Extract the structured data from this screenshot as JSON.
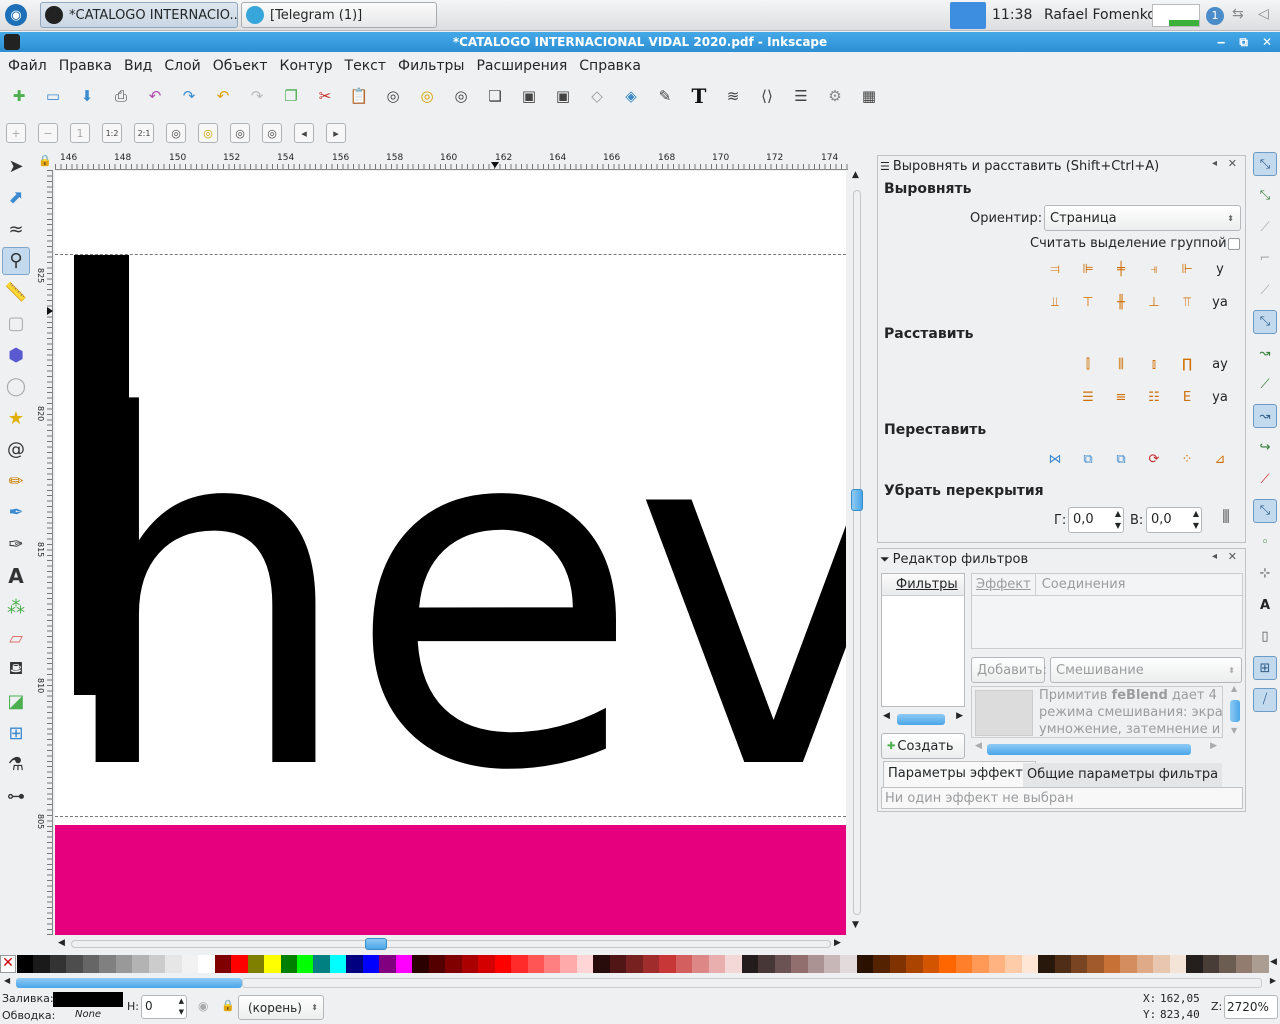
{
  "taskbar": {
    "tasks": [
      {
        "label": "*CATALOGO INTERNACIO..."
      },
      {
        "label": "[Telegram (1)]"
      }
    ],
    "clock": "11:38",
    "user": "Rafael Fomenko",
    "badge": "1"
  },
  "window": {
    "title": "*CATALOGO INTERNACIONAL VIDAL 2020.pdf - Inkscape",
    "controls": [
      "‒",
      "⧉",
      "✕"
    ]
  },
  "menu": [
    "Файл",
    "Правка",
    "Вид",
    "Слой",
    "Объект",
    "Контур",
    "Текст",
    "Фильтры",
    "Расширения",
    "Справка"
  ],
  "toolbar_icons": [
    "new-icon",
    "open-icon",
    "save-icon",
    "print-icon",
    "import-icon",
    "export-icon",
    "undo-icon",
    "redo-icon",
    "copy-icon",
    "cut-icon",
    "paste-icon",
    "zoom-selection-icon",
    "zoom-drawing-icon",
    "zoom-page-icon",
    "duplicate-icon",
    "clone-icon",
    "unlink-clone-icon",
    "group-icon",
    "ungroup-icon",
    "fill-stroke-icon",
    "text-font-icon",
    "layers-icon",
    "xml-editor-icon",
    "align-icon",
    "preferences-icon",
    "document-properties-icon"
  ],
  "zoom_toolbar": {
    "labels": [
      "+",
      "−",
      "1",
      "1:2",
      "2:1"
    ]
  },
  "ruler": {
    "ticks": [
      "146",
      "148",
      "150",
      "152",
      "154",
      "156",
      "158",
      "160",
      "162",
      "164",
      "166",
      "168",
      "170",
      "172",
      "174"
    ],
    "vticks": [
      "825",
      "820",
      "815",
      "810",
      "805"
    ]
  },
  "canvas": {
    "text": "hev",
    "page_color": "#ffffff",
    "band_color": "#e6007e"
  },
  "align_panel": {
    "title": "Выровнять и расставить (Shift+Ctrl+A)",
    "align_heading": "Выровнять",
    "relative_label": "Ориентир:",
    "relative_value": "Страница",
    "group_label": "Считать выделение группой:",
    "distribute_heading": "Расставить",
    "rearrange_heading": "Переставить",
    "overlap_heading": "Убрать перекрытия",
    "h_label": "Г:",
    "h_value": "0,0",
    "v_label": "В:",
    "v_value": "0,0"
  },
  "filter_panel": {
    "title": "Редактор фильтров",
    "col_filters": "Фильтры",
    "col_effect": "Эффект",
    "col_connections": "Соединения",
    "add_label": "Добавить:",
    "add_value": "Смешивание",
    "desc_prefix": "Примитив ",
    "desc_bold": "feBlend",
    "desc_line1": " дает 4",
    "desc_line2": "режима смешивания: экран,",
    "desc_line3": "умножение, затемнение и",
    "create_label": "Создать",
    "tab_effect": "Параметры эффекта",
    "tab_general": "Общие параметры фильтра",
    "no_effect": "Ни один эффект не выбран"
  },
  "status": {
    "fill_label": "Заливка:",
    "stroke_label": "Обводка:",
    "stroke_value": "None",
    "fill_color": "#000000",
    "h_label": "Н:",
    "h_value": "0",
    "layer": "(корень)",
    "x_label": "X:",
    "x_value": "162,05",
    "y_label": "Y:",
    "y_value": "823,40",
    "z_label": "Z:",
    "z_value": "2720%"
  },
  "palette": [
    "#000000",
    "#1a1a1a",
    "#333333",
    "#4d4d4d",
    "#666666",
    "#808080",
    "#999999",
    "#b3b3b3",
    "#cccccc",
    "#e6e6e6",
    "#f2f2f2",
    "#ffffff",
    "#800000",
    "#ff0000",
    "#808000",
    "#ffff00",
    "#008000",
    "#00ff00",
    "#008080",
    "#00ffff",
    "#000080",
    "#0000ff",
    "#800080",
    "#ff00ff",
    "#2b0000",
    "#550000",
    "#800000",
    "#aa0000",
    "#d40000",
    "#ff0000",
    "#ff2a2a",
    "#ff5555",
    "#ff8080",
    "#ffaaaa",
    "#ffd5d5",
    "#280b0b",
    "#501616",
    "#782121",
    "#a02c2c",
    "#c83737",
    "#d35f5f",
    "#de8787",
    "#e9afaf",
    "#f4d7d7",
    "#241c1c",
    "#483737",
    "#6c5353",
    "#916f6f",
    "#ac9393",
    "#c8b7b7",
    "#e3dbdb",
    "#2b1100",
    "#552200",
    "#803300",
    "#aa4400",
    "#d45500",
    "#ff6600",
    "#ff7f2a",
    "#ff9955",
    "#ffb380",
    "#ffccaa",
    "#ffe6d5",
    "#28170b",
    "#502d16",
    "#784421",
    "#a05a2c",
    "#c87137",
    "#d38d5f",
    "#deaa87",
    "#e9c6af",
    "#f4e3d7",
    "#241f1c",
    "#483e37",
    "#6c5d53",
    "#917c6f",
    "#ac9d93"
  ]
}
